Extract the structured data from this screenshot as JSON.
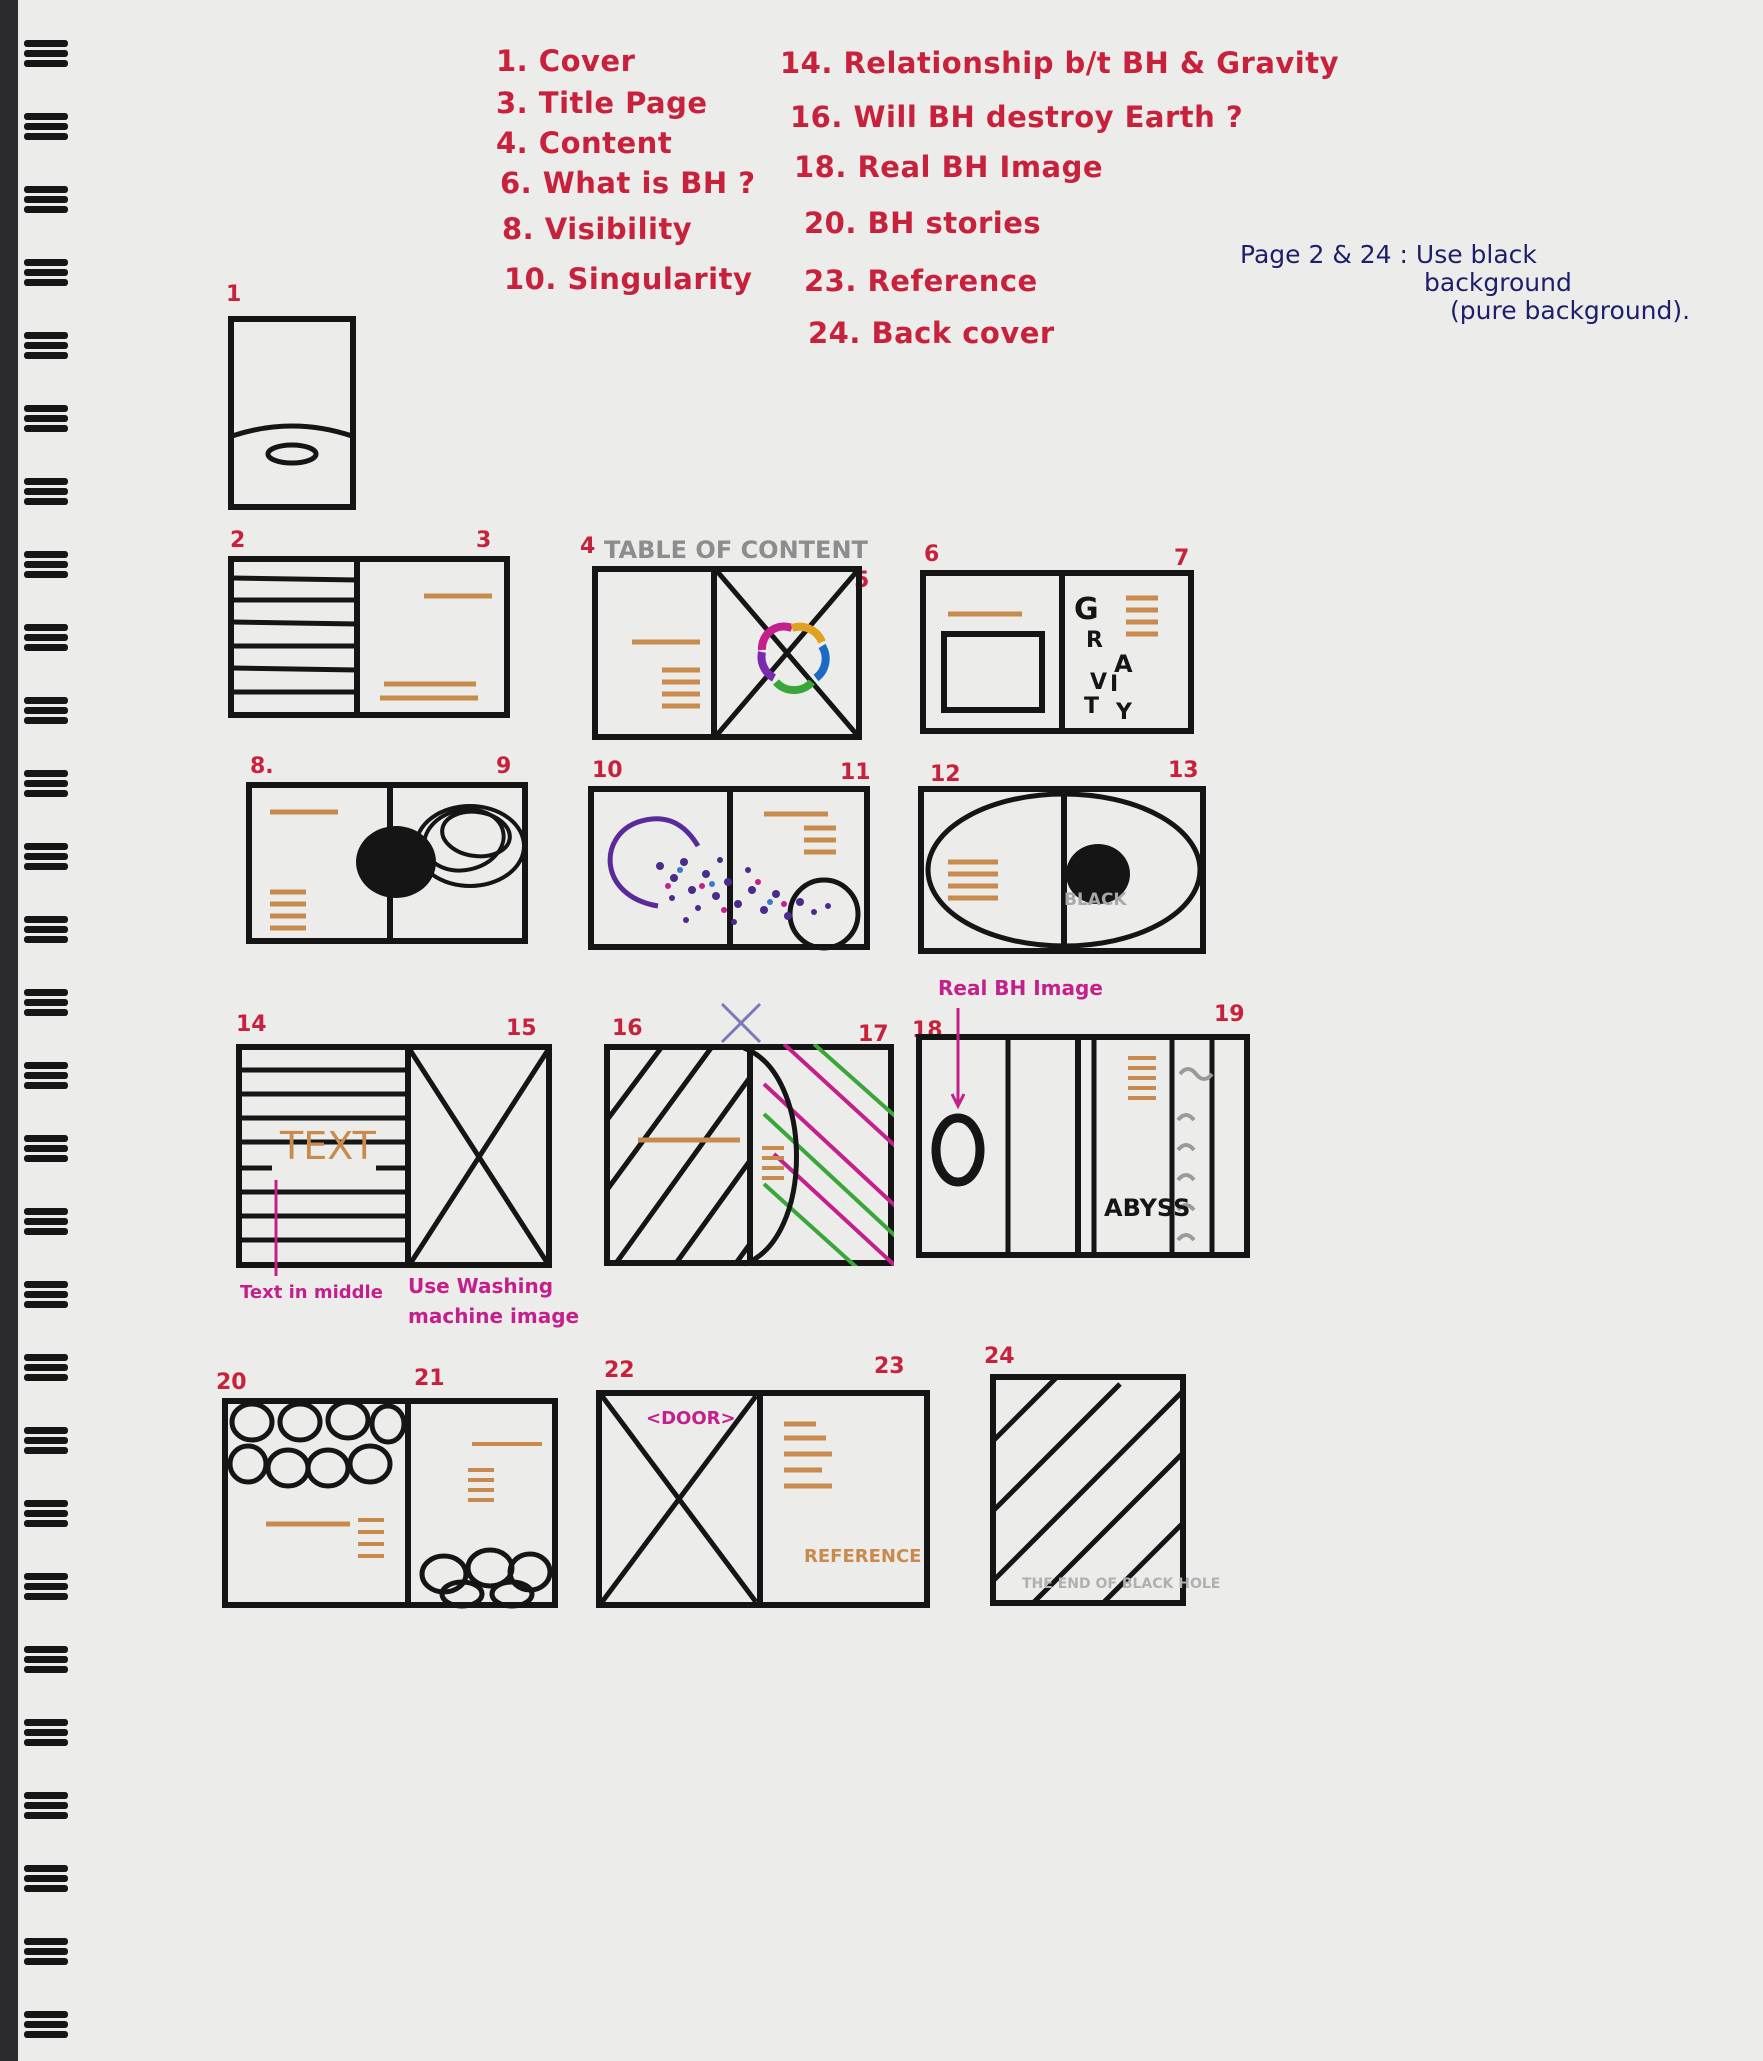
{
  "contents_left": [
    "1. Cover",
    "3. Title Page",
    "4. Content",
    "6. What is BH ?",
    "8. Visibility",
    "10. Singularity"
  ],
  "contents_right": [
    "14. Relationship b/t BH & Gravity",
    "16. Will BH destroy Earth ?",
    "18. Real BH Image",
    "20. BH stories",
    "23. Reference",
    "24. Back cover"
  ],
  "side_note": {
    "line1": "Page 2 & 24 : Use black",
    "line2": "background",
    "line3": "(pure background)."
  },
  "page_numbers": {
    "p1": "1",
    "p2": "2",
    "p3": "3",
    "p4": "4",
    "p5": "5",
    "p6": "6",
    "p7": "7",
    "p8": "8.",
    "p9": "9",
    "p10": "10",
    "p11": "11",
    "p12": "12",
    "p13": "13",
    "p14": "14",
    "p15": "15",
    "p16": "16",
    "p17": "17",
    "p18": "18",
    "p19": "19",
    "p20": "20",
    "p21": "21",
    "p22": "22",
    "p23": "23",
    "p24": "24"
  },
  "sketch_labels": {
    "table_of_content": "TABLE OF CONTENT",
    "gravity_letters": [
      "G",
      "R",
      "A",
      "V",
      "I",
      "T",
      "Y"
    ],
    "black": "BLACK",
    "real_bh_image": "Real BH Image",
    "text": "TEXT",
    "text_in_middle": "Text in middle",
    "washing_1": "Use Washing",
    "washing_2": "machine image",
    "abyss": "ABYSS",
    "door": "<DOOR>",
    "reference": "REFERENCE",
    "back_cover_text": "THE END OF BLACK HOLE"
  },
  "colors": {
    "red_ink": "#c8213c",
    "navy_ink": "#1d1f6b",
    "magenta_ink": "#c4208c",
    "orange_ink": "#c98a4e",
    "black_ink": "#151515",
    "paper": "#ececea"
  }
}
